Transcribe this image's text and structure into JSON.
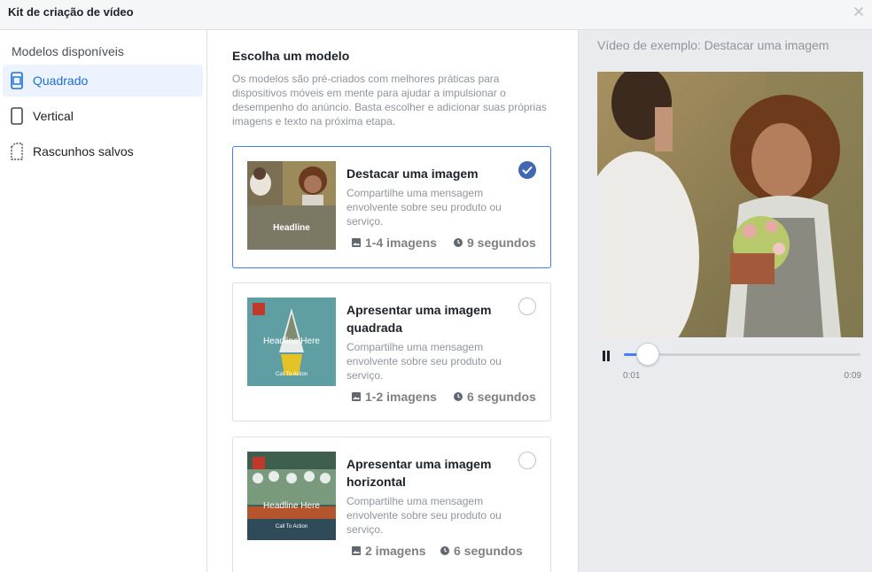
{
  "dialog": {
    "title": "Kit de criação de vídeo"
  },
  "sidebar": {
    "heading": "Modelos disponíveis",
    "items": [
      {
        "label": "Quadrado",
        "icon": "square-phone-icon",
        "active": true
      },
      {
        "label": "Vertical",
        "icon": "vertical-phone-icon",
        "active": false
      },
      {
        "label": "Rascunhos salvos",
        "icon": "draft-document-icon",
        "active": false
      }
    ]
  },
  "main": {
    "title": "Escolha um modelo",
    "description": "Os modelos são pré-criados com melhores práticas para dispositivos móveis em mente para ajudar a impulsionar o desempenho do anúncio. Basta escolher e adicionar suas próprias imagens e texto na próxima etapa.",
    "templates": [
      {
        "title": "Destacar uma imagem",
        "description": "Compartilhe uma mensagem envolvente sobre seu produto ou serviço.",
        "images": "1-4 imagens",
        "duration": "9 segundos",
        "thumb_headline": "Headline",
        "selected": true
      },
      {
        "title": "Apresentar uma imagem quadrada",
        "description": "Compartilhe uma mensagem envolvente sobre seu produto ou serviço.",
        "images": "1-2 imagens",
        "duration": "6 segundos",
        "thumb_headline": "Headline Here",
        "thumb_cta": "Call To Action",
        "selected": false
      },
      {
        "title": "Apresentar uma imagem horizontal",
        "description": "Compartilhe uma mensagem envolvente sobre seu produto ou serviço.",
        "images": "2 imagens",
        "duration": "6 segundos",
        "thumb_headline": "Headline Here",
        "thumb_cta": "Call To Action",
        "selected": false
      }
    ]
  },
  "preview": {
    "title": "Vídeo de exemplo: Destacar uma imagem",
    "current_time": "0:01",
    "total_time": "0:09",
    "progress": 0.1
  },
  "colors": {
    "accent": "#4267b2",
    "selected_border": "#4080ff",
    "active_bg": "#ecf3ff",
    "active_text": "#1c6fd1"
  }
}
